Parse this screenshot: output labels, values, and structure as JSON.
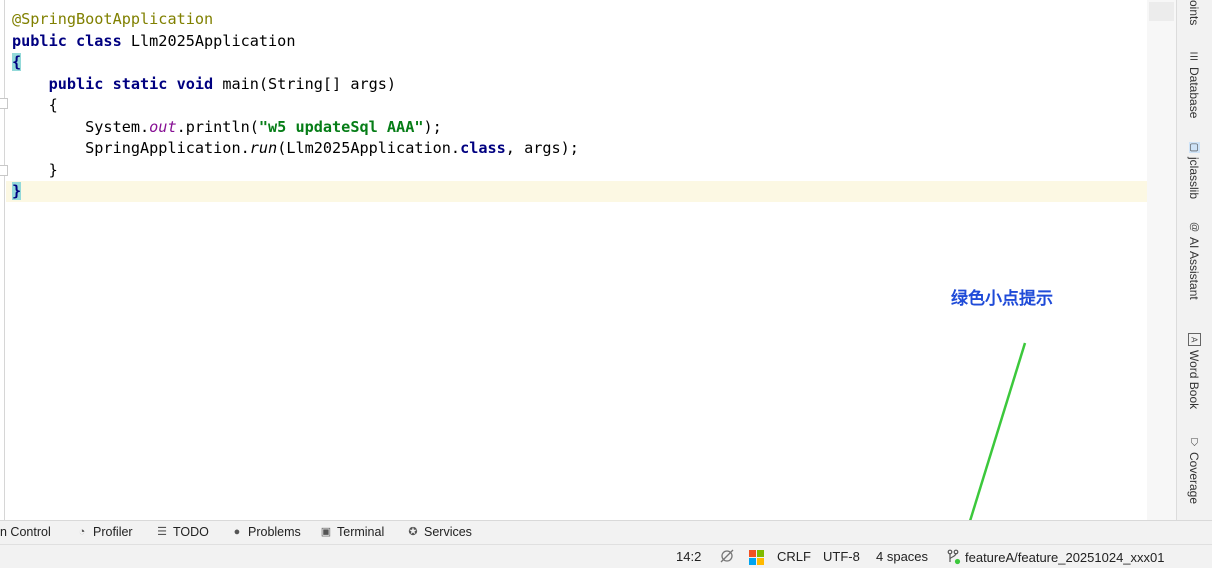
{
  "editor": {
    "lines": [
      {
        "segments": [
          {
            "t": "@SpringBootApplication",
            "c": "anno"
          }
        ]
      },
      {
        "segments": [
          {
            "t": "public class ",
            "c": "kw"
          },
          {
            "t": "Llm2025Application",
            "c": ""
          }
        ]
      },
      {
        "segments": [
          {
            "t": "{",
            "c": "brace-hl"
          }
        ]
      },
      {
        "segments": [
          {
            "t": "    ",
            "c": ""
          },
          {
            "t": "public static void ",
            "c": "kw"
          },
          {
            "t": "main(String[] args)",
            "c": ""
          }
        ]
      },
      {
        "segments": [
          {
            "t": "    {",
            "c": ""
          }
        ]
      },
      {
        "segments": [
          {
            "t": "        System.",
            "c": ""
          },
          {
            "t": "out",
            "c": "static-f"
          },
          {
            "t": ".println(",
            "c": ""
          },
          {
            "t": "\"w5 updateSql AAA\"",
            "c": "str"
          },
          {
            "t": ");",
            "c": ""
          }
        ]
      },
      {
        "segments": [
          {
            "t": "        SpringApplication.",
            "c": ""
          },
          {
            "t": "run",
            "c": "static-m"
          },
          {
            "t": "(Llm2025Application.",
            "c": ""
          },
          {
            "t": "class",
            "c": "kw"
          },
          {
            "t": ", args);",
            "c": ""
          }
        ]
      },
      {
        "segments": [
          {
            "t": "    }",
            "c": ""
          }
        ]
      },
      {
        "segments": [
          {
            "t": "}",
            "c": "brace-hl"
          }
        ]
      }
    ]
  },
  "tool_stripe": {
    "tabs": [
      {
        "label": "oints",
        "icon": "breakpoints-icon"
      },
      {
        "label": "Database",
        "icon": "database-icon"
      },
      {
        "label": "jclasslib",
        "icon": "jclasslib-icon"
      },
      {
        "label": "AI Assistant",
        "icon": "ai-assistant-icon"
      },
      {
        "label": "Word Book",
        "icon": "word-book-icon"
      },
      {
        "label": "Coverage",
        "icon": "coverage-icon"
      }
    ]
  },
  "annotation": {
    "text": "绿色小点提示",
    "color": "#1f4bd8",
    "arrow_color": "#3cc83c"
  },
  "toolwin_bar": {
    "items": [
      {
        "label": "n Control",
        "icon": ""
      },
      {
        "label": "Profiler",
        "icon": "profiler-icon"
      },
      {
        "label": "TODO",
        "icon": "todo-icon"
      },
      {
        "label": "Problems",
        "icon": "problems-icon"
      },
      {
        "label": "Terminal",
        "icon": "terminal-icon"
      },
      {
        "label": "Services",
        "icon": "services-icon"
      }
    ]
  },
  "status_bar": {
    "position": "14:2",
    "line_separator": "CRLF",
    "encoding": "UTF-8",
    "indent": "4 spaces",
    "branch": "featureA/feature_20251024_xxx01",
    "branch_dot_color": "#3cc83c"
  }
}
